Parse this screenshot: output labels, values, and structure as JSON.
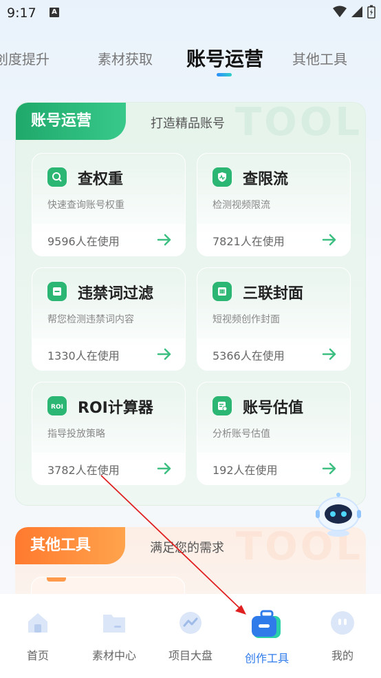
{
  "status": {
    "time": "9:17",
    "notif": "A"
  },
  "tabs": [
    "创度提升",
    "素材获取",
    "账号运营",
    "其他工具"
  ],
  "section1": {
    "tag": "账号运营",
    "subtitle": "打造精品账号",
    "watermark": "TOOL",
    "tools": [
      {
        "title": "查权重",
        "desc": "快速查询账号权重",
        "count": "9596人在使用",
        "icon": "search-icon"
      },
      {
        "title": "查限流",
        "desc": "检测视频限流",
        "count": "7821人在使用",
        "icon": "shield-icon"
      },
      {
        "title": "违禁词过滤",
        "desc": "帮您检测违禁词内容",
        "count": "1330人在使用",
        "icon": "filter-icon"
      },
      {
        "title": "三联封面",
        "desc": "短视频创作封面",
        "count": "5366人在使用",
        "icon": "grid-icon"
      },
      {
        "title": "ROI计算器",
        "desc": "指导投放策略",
        "count": "3782人在使用",
        "icon": "roi-icon"
      },
      {
        "title": "账号估值",
        "desc": "分析账号估值",
        "count": "192人在使用",
        "icon": "valuation-icon"
      }
    ]
  },
  "section2": {
    "tag": "其他工具",
    "subtitle": "满足您的需求",
    "watermark": "TOOL"
  },
  "nav": [
    {
      "label": "首页",
      "icon": "home-icon"
    },
    {
      "label": "素材中心",
      "icon": "folder-icon"
    },
    {
      "label": "项目大盘",
      "icon": "chart-icon"
    },
    {
      "label": "创作工具",
      "icon": "toolbox-icon",
      "active": true
    },
    {
      "label": "我的",
      "icon": "profile-icon"
    }
  ],
  "colors": {
    "accent_green": "#2bb673",
    "accent_orange": "#ff7a2e",
    "nav_active": "#2f7bea",
    "annotation_red": "#e02020"
  }
}
